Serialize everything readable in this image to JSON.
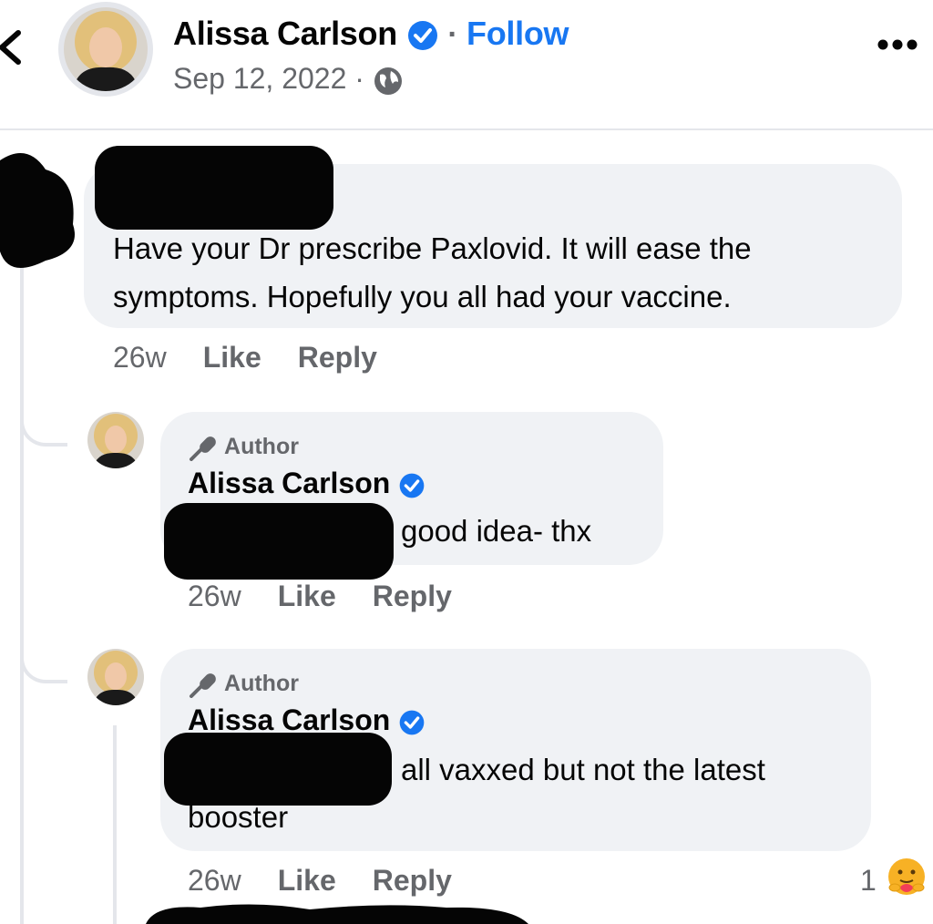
{
  "header": {
    "poster_name": "Alissa Carlson",
    "separator": "·",
    "follow_label": "Follow",
    "date": "Sep 12, 2022 ·"
  },
  "comments": [
    {
      "text": "Have your Dr prescribe Paxlovid. It will ease the symptoms. Hopefully you all had your vaccine.",
      "time": "26w",
      "like_label": "Like",
      "reply_label": "Reply"
    }
  ],
  "replies": [
    {
      "badge": "Author",
      "name": "Alissa Carlson",
      "text": "good idea- thx",
      "time": "26w",
      "like_label": "Like",
      "reply_label": "Reply"
    },
    {
      "badge": "Author",
      "name": "Alissa Carlson",
      "text_line1": "all vaxxed but not the latest",
      "text_line2": "booster",
      "time": "26w",
      "like_label": "Like",
      "reply_label": "Reply",
      "reaction_count": "1",
      "reaction_icon": "care-emoji-icon"
    }
  ],
  "colors": {
    "accent": "#1877f2",
    "bubble": "#f0f2f5",
    "secondary_text": "#65676b"
  }
}
